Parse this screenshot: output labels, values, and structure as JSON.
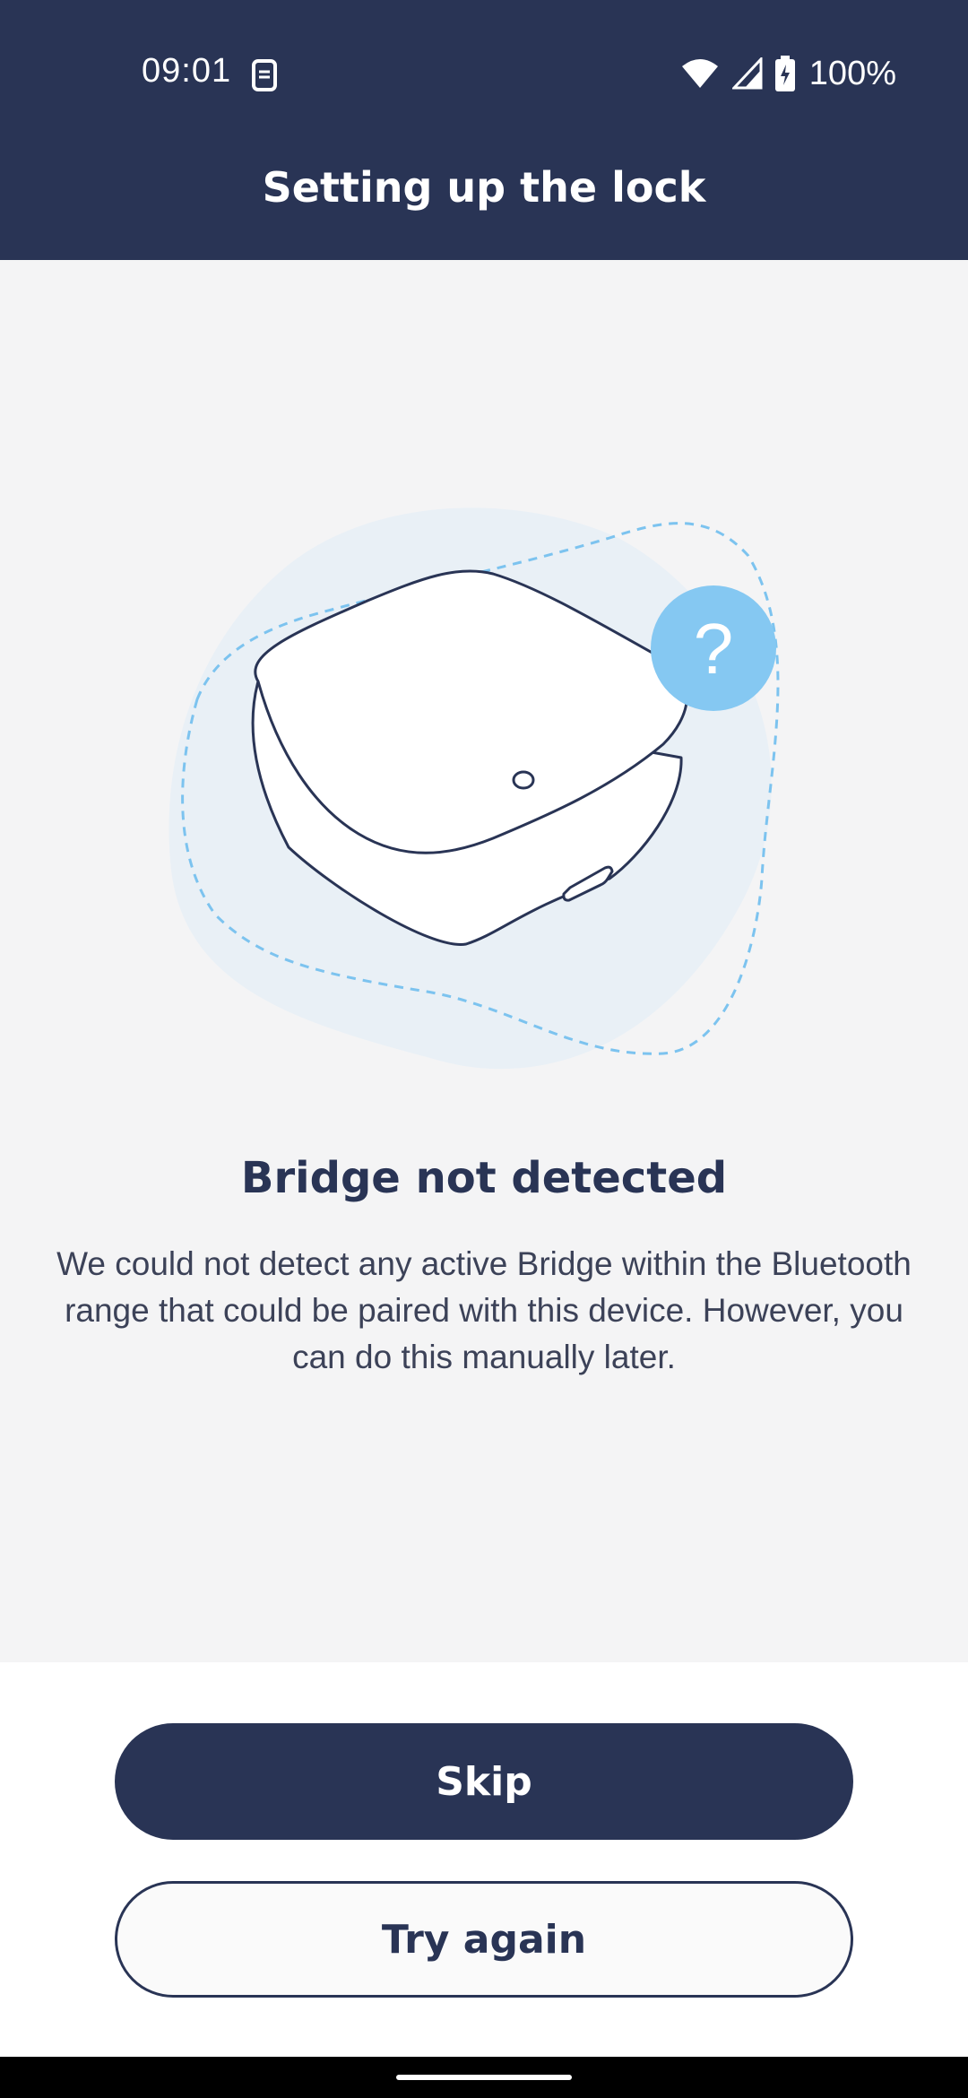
{
  "status_bar": {
    "time": "09:01",
    "battery": "100%"
  },
  "header": {
    "title": "Setting up the lock"
  },
  "illustration": {
    "badge_symbol": "?"
  },
  "content": {
    "title": "Bridge not detected",
    "description": "We could not detect any active Bridge within the Bluetooth range that could be paired with this device. However, you can do this manually later."
  },
  "buttons": {
    "skip": "Skip",
    "try_again": "Try again"
  },
  "colors": {
    "primary": "#293455",
    "accent": "#85c8f2",
    "background": "#f4f4f5"
  }
}
